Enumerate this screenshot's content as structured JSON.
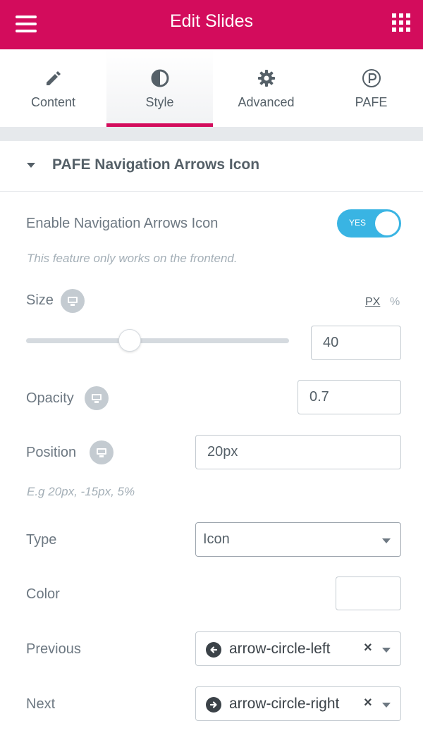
{
  "header": {
    "title": "Edit Slides",
    "background_color": "#d30c5c"
  },
  "tabs": [
    {
      "label": "Content",
      "icon": "pencil-icon",
      "active": false
    },
    {
      "label": "Style",
      "icon": "half-circle-icon",
      "active": true
    },
    {
      "label": "Advanced",
      "icon": "gear-icon",
      "active": false
    },
    {
      "label": "PAFE",
      "icon": "pafe-logo-icon",
      "active": false
    }
  ],
  "section": {
    "title": "PAFE Navigation Arrows Icon",
    "expanded": true
  },
  "controls": {
    "enable_arrows": {
      "label": "Enable Navigation Arrows Icon",
      "toggle_label": "YES",
      "enabled": true,
      "note": "This feature only works on the frontend."
    },
    "size": {
      "label": "Size",
      "unit_px": "PX",
      "unit_percent": "%",
      "selected_unit": "PX",
      "value": "40"
    },
    "opacity": {
      "label": "Opacity",
      "value": "0.7"
    },
    "position": {
      "label": "Position",
      "value": "20px",
      "hint": "E.g 20px, -15px, 5%"
    },
    "type": {
      "label": "Type",
      "value": "Icon"
    },
    "color": {
      "label": "Color",
      "value": ""
    },
    "previous": {
      "label": "Previous",
      "value": "arrow-circle-left",
      "icon": "arrow-circle-left-icon"
    },
    "next": {
      "label": "Next",
      "value": "arrow-circle-right",
      "icon": "arrow-circle-right-icon"
    }
  },
  "colors": {
    "accent": "#d30c5c",
    "toggle_on": "#39b4e3",
    "text": "#556068",
    "muted": "#a4afb7"
  }
}
